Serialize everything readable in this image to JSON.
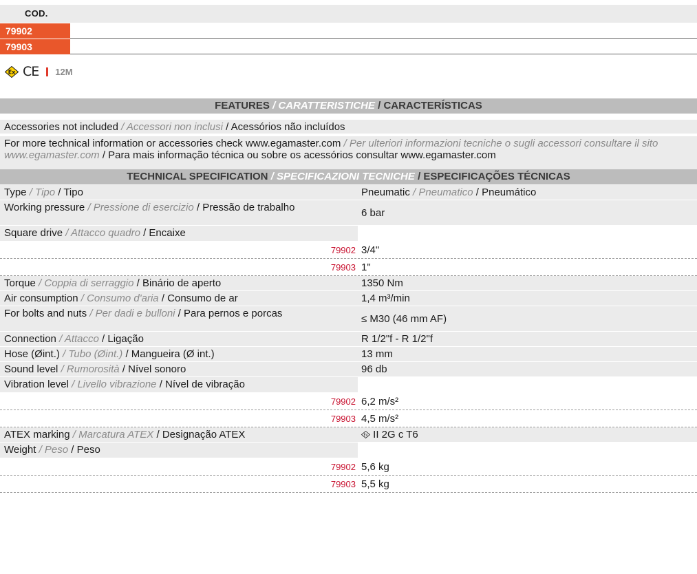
{
  "codes": {
    "header": "COD.",
    "items": [
      "79902",
      "79903"
    ]
  },
  "certifications": {
    "icons": [
      "atex-ex-icon",
      "ce-mark-icon"
    ],
    "ce_text": "CE",
    "warranty": "12M"
  },
  "features": {
    "title_en": "FEATURES",
    "title_it": "/ CARATTERISTICHE",
    "title_pt": "/ CARACTERÍSTICAS",
    "rows": [
      {
        "en": "Accessories not included",
        "it": "/ Accessori non inclusi",
        "pt": "/ Acessórios não incluídos"
      },
      {
        "en": "For more technical information or accessories check www.egamaster.com",
        "it": "/ Per ulteriori informazioni tecniche o sugli accessori consultare il sito www.egamaster.com",
        "pt": "/ Para mais informação técnica ou sobre os acessórios consultar www.egamaster.com"
      }
    ]
  },
  "spec": {
    "title_en": "TECHNICAL SPECIFICATION",
    "title_it": "/ SPECIFICAZIONI TECNICHE",
    "title_pt": "/ ESPECIFICAÇÕES TÉCNICAS",
    "type": {
      "en": "Type",
      "it": "/ Tipo",
      "pt": "/ Tipo",
      "v_en": "Pneumatic",
      "v_it": "/ Pneumatico",
      "v_pt": "/ Pneumático"
    },
    "pressure": {
      "en": "Working pressure",
      "it": "/ Pressione di esercizio",
      "pt": "/ Pressão de trabalho",
      "value": "6 bar"
    },
    "square": {
      "en": "Square drive",
      "it": "/ Attacco quadro",
      "pt": "/ Encaixe",
      "subs": [
        {
          "code": "79902",
          "value": "3/4\""
        },
        {
          "code": "79903",
          "value": "1\""
        }
      ]
    },
    "torque": {
      "en": "Torque",
      "it": "/ Coppia di serraggio",
      "pt": "/ Binário de aperto",
      "value": "1350 Nm"
    },
    "air": {
      "en": "Air consumption",
      "it": "/ Consumo d'aria",
      "pt": "/ Consumo de ar",
      "value": "1,4 m³/min"
    },
    "bolts": {
      "en": "For bolts and nuts",
      "it": "/ Per dadi e bulloni",
      "pt": "/ Para pernos e porcas",
      "value": "≤ M30 (46 mm AF)"
    },
    "connection": {
      "en": "Connection",
      "it": "/ Attacco",
      "pt": "/ Ligação",
      "value": "R 1/2\"f - R 1/2\"f"
    },
    "hose": {
      "en": "Hose (Øint.)",
      "it": "/ Tubo (Øint.)",
      "pt": "/ Mangueira (Ø int.)",
      "value": "13 mm"
    },
    "sound": {
      "en": "Sound level",
      "it": "/ Rumorosità",
      "pt": "/ Nível sonoro",
      "value": "96 db"
    },
    "vibration": {
      "en": "Vibration level",
      "it": "/ Livello vibrazione",
      "pt": "/ Nível de vibração",
      "subs": [
        {
          "code": "79902",
          "value": "6,2 m/s²"
        },
        {
          "code": "79903",
          "value": "4,5 m/s²"
        }
      ]
    },
    "atex": {
      "en": "ATEX marking",
      "it": "/ Marcatura ATEX",
      "pt": "/ Designação ATEX",
      "value": "II 2G c T6"
    },
    "weight": {
      "en": "Weight",
      "it": "/ Peso",
      "pt": "/ Peso",
      "subs": [
        {
          "code": "79902",
          "value": "5,6 kg"
        },
        {
          "code": "79903",
          "value": "5,5 kg"
        }
      ]
    }
  },
  "colors": {
    "accent": "#e9572b",
    "code_red": "#c8102e",
    "bar_gray": "#bcbcbc",
    "row_gray": "#ebebeb"
  }
}
